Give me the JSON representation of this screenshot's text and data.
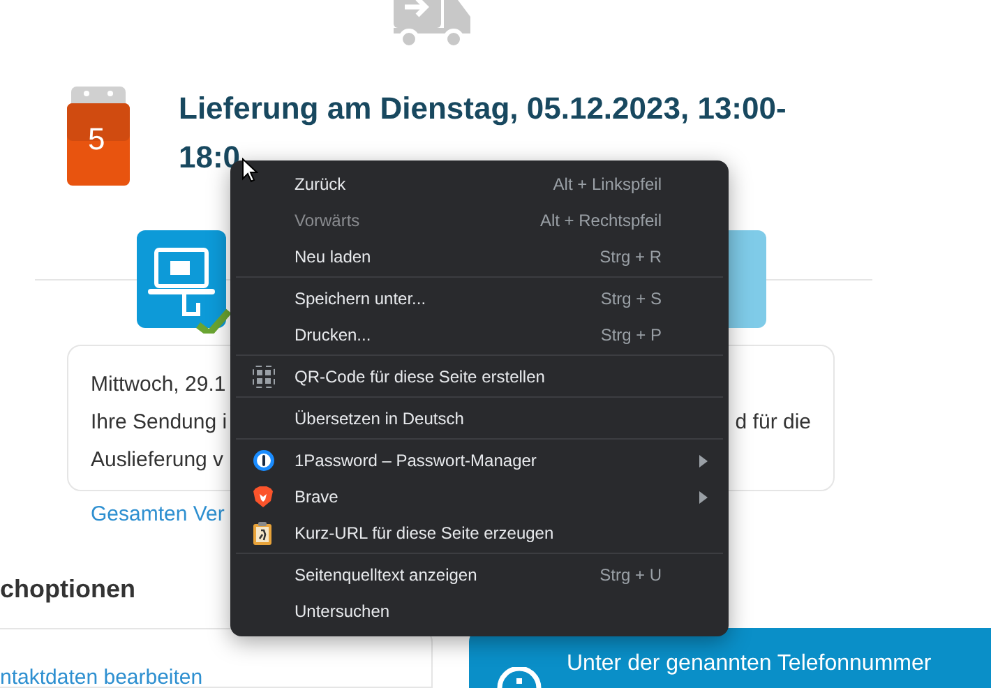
{
  "heading": {
    "line_1": "Lieferung am Dienstag, 05.12.2023, 13:00-",
    "line_2": "18:0"
  },
  "calendar": {
    "day": "5"
  },
  "status_card": {
    "date": "Mittwoch, 29.1",
    "line_1_start": "Ihre Sendung i",
    "line_1_end": "d für die",
    "line_2_start": "Auslieferung v"
  },
  "history_link": "Gesamten Ver",
  "options_heading": "choptionen",
  "contact_link": "ntaktdaten bearbeiten",
  "info_panel": {
    "text": "Unter der genannten Telefonnummer"
  },
  "context_menu": {
    "sections": [
      [
        {
          "label": "Zurück",
          "shortcut": "Alt + Linkspfeil",
          "disabled": false,
          "kind": "plain",
          "submenu": false
        },
        {
          "label": "Vorwärts",
          "shortcut": "Alt + Rechtspfeil",
          "disabled": true,
          "kind": "plain",
          "submenu": false
        },
        {
          "label": "Neu laden",
          "shortcut": "Strg + R",
          "disabled": false,
          "kind": "plain",
          "submenu": false
        }
      ],
      [
        {
          "label": "Speichern unter...",
          "shortcut": "Strg + S",
          "disabled": false,
          "kind": "plain",
          "submenu": false
        },
        {
          "label": "Drucken...",
          "shortcut": "Strg + P",
          "disabled": false,
          "kind": "plain",
          "submenu": false
        }
      ],
      [
        {
          "label": "QR-Code für diese Seite erstellen",
          "disabled": false,
          "kind": "qr",
          "submenu": false
        }
      ],
      [
        {
          "label": "Übersetzen in Deutsch",
          "disabled": false,
          "kind": "plain",
          "submenu": false
        }
      ],
      [
        {
          "label": "1Password – Passwort-Manager",
          "disabled": false,
          "kind": "password",
          "submenu": true
        },
        {
          "label": "Brave",
          "disabled": false,
          "kind": "brave",
          "submenu": true
        },
        {
          "label": "Kurz-URL für diese Seite erzeugen",
          "disabled": false,
          "kind": "shortlink",
          "submenu": false
        }
      ],
      [
        {
          "label": "Seitenquelltext anzeigen",
          "shortcut": "Strg + U",
          "disabled": false,
          "kind": "plain",
          "submenu": false
        },
        {
          "label": "Untersuchen",
          "disabled": false,
          "kind": "plain",
          "submenu": false
        }
      ]
    ]
  }
}
